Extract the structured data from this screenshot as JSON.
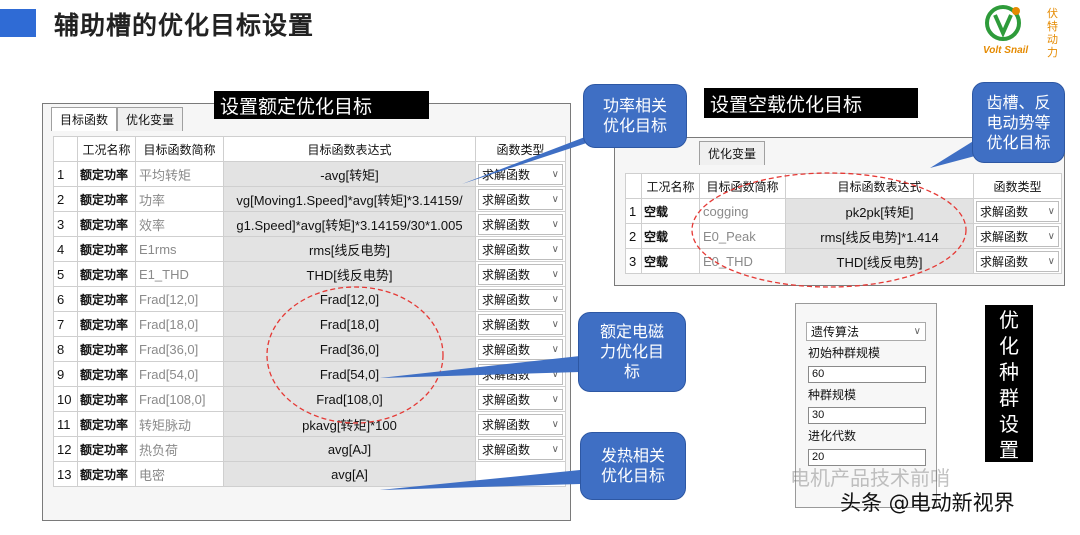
{
  "header": {
    "title": "辅助槽的优化目标设置",
    "accent_color": "#2f6bd5"
  },
  "logo": {
    "brand": "Volt Snail",
    "vertical_text": "伏特动力"
  },
  "left_dialog": {
    "tabs": [
      "目标函数",
      "优化变量"
    ],
    "label": "设置额定优化目标",
    "columns": [
      "工况名称",
      "目标函数简称",
      "目标函数表达式",
      "函数类型"
    ],
    "rows": [
      {
        "idx": "1",
        "cond": "额定功率",
        "abbr": "平均转矩",
        "expr": "-avg[转矩]",
        "type": "求解函数"
      },
      {
        "idx": "2",
        "cond": "额定功率",
        "abbr": "功率",
        "expr": "vg[Moving1.Speed]*avg[转矩]*3.14159/",
        "type": "求解函数"
      },
      {
        "idx": "3",
        "cond": "额定功率",
        "abbr": "效率",
        "expr": "g1.Speed]*avg[转矩]*3.14159/30*1.005",
        "type": "求解函数"
      },
      {
        "idx": "4",
        "cond": "额定功率",
        "abbr": "E1rms",
        "expr": "rms[线反电势]",
        "type": "求解函数"
      },
      {
        "idx": "5",
        "cond": "额定功率",
        "abbr": "E1_THD",
        "expr": "THD[线反电势]",
        "type": "求解函数"
      },
      {
        "idx": "6",
        "cond": "额定功率",
        "abbr": "Frad[12,0]",
        "expr": "Frad[12,0]",
        "type": "求解函数"
      },
      {
        "idx": "7",
        "cond": "额定功率",
        "abbr": "Frad[18,0]",
        "expr": "Frad[18,0]",
        "type": "求解函数"
      },
      {
        "idx": "8",
        "cond": "额定功率",
        "abbr": "Frad[36,0]",
        "expr": "Frad[36,0]",
        "type": "求解函数"
      },
      {
        "idx": "9",
        "cond": "额定功率",
        "abbr": "Frad[54,0]",
        "expr": "Frad[54,0]",
        "type": "求解函数"
      },
      {
        "idx": "10",
        "cond": "额定功率",
        "abbr": "Frad[108,0]",
        "expr": "Frad[108,0]",
        "type": "求解函数"
      },
      {
        "idx": "11",
        "cond": "额定功率",
        "abbr": "转矩脉动",
        "expr": "pkavg[转矩]*100",
        "type": "求解函数"
      },
      {
        "idx": "12",
        "cond": "额定功率",
        "abbr": "热负荷",
        "expr": "avg[AJ]",
        "type": "求解函数"
      },
      {
        "idx": "13",
        "cond": "额定功率",
        "abbr": "电密",
        "expr": "avg[A]",
        "type": ""
      }
    ]
  },
  "right_dialog": {
    "tabs": [
      "优化变量"
    ],
    "label": "设置空载优化目标",
    "columns": [
      "工况名称",
      "目标函数简称",
      "目标函数表达式",
      "函数类型"
    ],
    "rows": [
      {
        "idx": "1",
        "cond": "空载",
        "abbr": "cogging",
        "expr": "pk2pk[转矩]",
        "type": "求解函数"
      },
      {
        "idx": "2",
        "cond": "空载",
        "abbr": "E0_Peak",
        "expr": "rms[线反电势]*1.414",
        "type": "求解函数"
      },
      {
        "idx": "3",
        "cond": "空载",
        "abbr": "E0_THD",
        "expr": "THD[线反电势]",
        "type": "求解函数"
      }
    ]
  },
  "callouts": {
    "power": "功率相关\n优化目标",
    "cogging": "齿槽、反\n电动势等\n优化目标",
    "emforce": "额定电磁\n力优化目\n标",
    "heat": "发热相关\n优化目标"
  },
  "optimization": {
    "algorithm": "遗传算法",
    "init_pop_label": "初始种群规模",
    "init_pop_value": "60",
    "pop_label": "种群规模",
    "pop_value": "30",
    "gen_label": "进化代数",
    "gen_value": "20",
    "vertical_label": "优化种群设置"
  },
  "watermark": {
    "line1": "电机产品技术前哨",
    "line2": "头条 @电动新视界"
  }
}
